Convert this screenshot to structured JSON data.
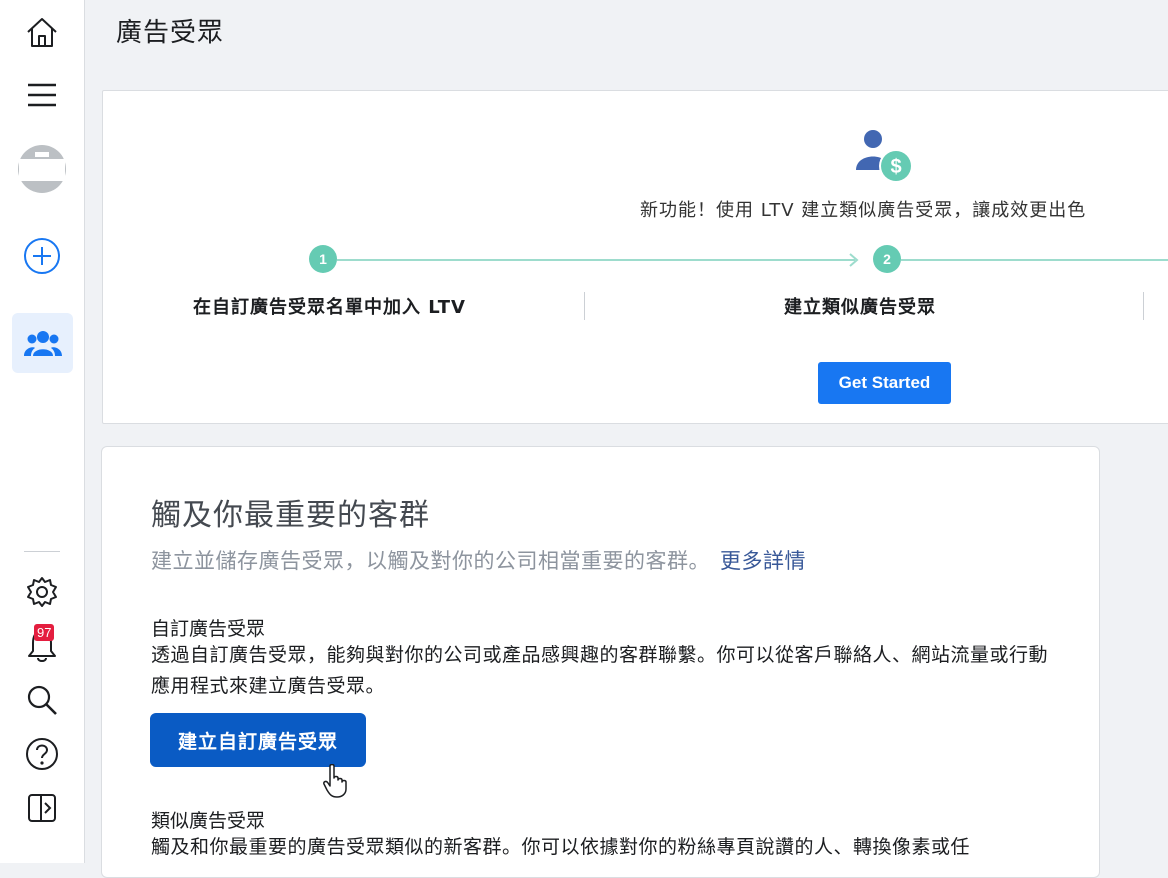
{
  "header": {
    "title": "廣告受眾"
  },
  "sidebar": {
    "icons": [
      "home-icon",
      "menu-icon",
      "account-avatar",
      "create-icon",
      "audiences-icon",
      "settings-icon",
      "notifications-icon",
      "search-icon",
      "help-icon",
      "panel-icon"
    ],
    "notifications_badge": "97"
  },
  "ltv_banner": {
    "headline": "新功能！使用 LTV 建立類似廣告受眾，讓成效更出色",
    "steps": [
      {
        "number": "1",
        "label": "在自訂廣告受眾名單中加入 LTV"
      },
      {
        "number": "2",
        "label": "建立類似廣告受眾"
      }
    ],
    "get_started_label": "Get Started"
  },
  "audiences": {
    "title": "觸及你最重要的客群",
    "subtitle": "建立並儲存廣告受眾，以觸及對你的公司相當重要的客群。",
    "learn_more": "更多詳情",
    "custom": {
      "heading": "自訂廣告受眾",
      "description": "透過自訂廣告受眾，能夠與對你的公司或產品感興趣的客群聯繫。你可以從客戶聯絡人、網站流量或行動應用程式來建立廣告受眾。",
      "button_label": "建立自訂廣告受眾"
    },
    "lookalike": {
      "heading": "類似廣告受眾",
      "description": "觸及和你最重要的廣告受眾類似的新客群。你可以依據對你的粉絲專頁說讚的人、轉換像素或任"
    }
  },
  "colors": {
    "accent": "#1877f2",
    "primary_button": "#0a5bc4",
    "step_teal": "#65cbb3",
    "badge_red": "#e41e3f"
  }
}
